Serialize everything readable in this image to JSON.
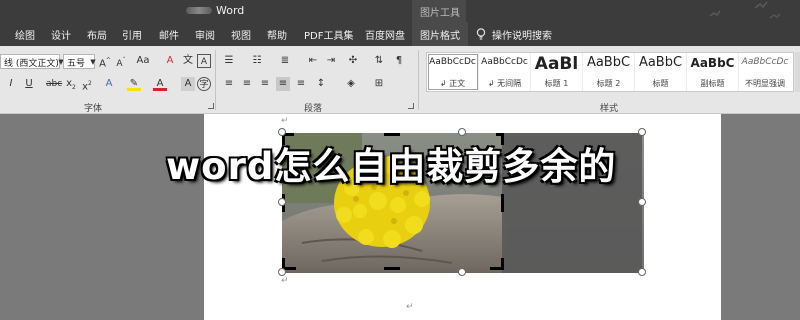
{
  "titlebar": {
    "doc_title": "Word",
    "context_group": "图片工具"
  },
  "tabs": [
    "绘图",
    "设计",
    "布局",
    "引用",
    "邮件",
    "审阅",
    "视图",
    "帮助",
    "PDF工具集",
    "百度网盘",
    "图片格式"
  ],
  "tell_me": "操作说明搜索",
  "font": {
    "name": "(西文正文)",
    "name_prefix": "线",
    "size": "五号"
  },
  "groups": {
    "font": "字体",
    "paragraph": "段落",
    "styles": "样式"
  },
  "styles": [
    {
      "sample": "AaBbCcDc",
      "name": "↲ 正文"
    },
    {
      "sample": "AaBbCcDc",
      "name": "↲ 无间隔"
    },
    {
      "sample": "AaBl",
      "name": "标题 1"
    },
    {
      "sample": "AaBbC",
      "name": "标题 2"
    },
    {
      "sample": "AaBbC",
      "name": "标题"
    },
    {
      "sample": "AaBbC",
      "name": "副标题"
    },
    {
      "sample": "AaBbCcDc",
      "name": "不明显强调"
    }
  ],
  "overlay_title": "word怎么自由裁剪多余的",
  "paragraph_mark": "↵"
}
